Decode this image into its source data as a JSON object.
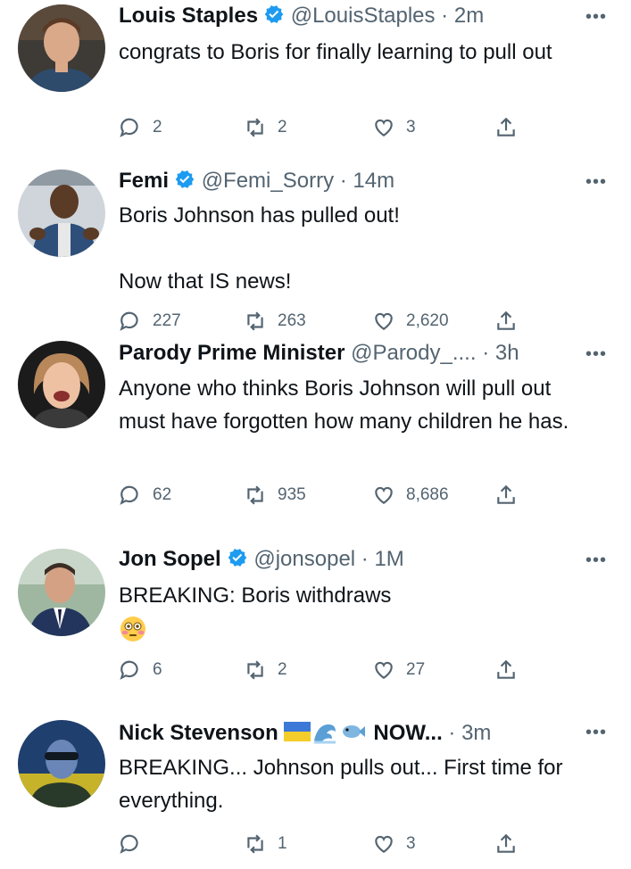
{
  "tweets": [
    {
      "name": "Louis Staples",
      "verified": true,
      "handle": "@LouisStaples",
      "time": "2m",
      "text": "congrats to Boris for finally learning to pull out",
      "replies": "2",
      "retweets": "2",
      "likes": "3"
    },
    {
      "name": "Femi",
      "verified": true,
      "handle": "@Femi_Sorry",
      "time": "14m",
      "text": "Boris Johnson has pulled out!\n\nNow that IS news!",
      "replies": "227",
      "retweets": "263",
      "likes": "2,620"
    },
    {
      "name": "Parody Prime Minister",
      "verified": false,
      "handle": "@Parody_....",
      "time": "3h",
      "text": "Anyone who thinks Boris Johnson will pull out must have forgotten how many children he has.",
      "replies": "62",
      "retweets": "935",
      "likes": "8,686"
    },
    {
      "name": "Jon Sopel",
      "verified": true,
      "handle": "@jonsopel",
      "time": "1M",
      "text": "BREAKING: Boris withdraws",
      "emoji": "flushed-face",
      "replies": "6",
      "retweets": "2",
      "likes": "27"
    },
    {
      "name": "Nick Stevenson",
      "name_emojis": [
        "ukraine-flag",
        "wave",
        "fish"
      ],
      "name_suffix": "NOW...",
      "verified": false,
      "handle": "",
      "time": "3m",
      "text": "BREAKING... Johnson pulls out... First time for everything.",
      "replies": "",
      "retweets": "1",
      "likes": "3"
    }
  ],
  "separator": "·",
  "more_label": "•••",
  "colors": {
    "verified": "#1d9bf0",
    "text": "#0f1419",
    "muted": "#536471"
  },
  "icons": [
    "reply-icon",
    "retweet-icon",
    "like-icon",
    "share-icon",
    "verified-badge-icon",
    "more-icon"
  ]
}
